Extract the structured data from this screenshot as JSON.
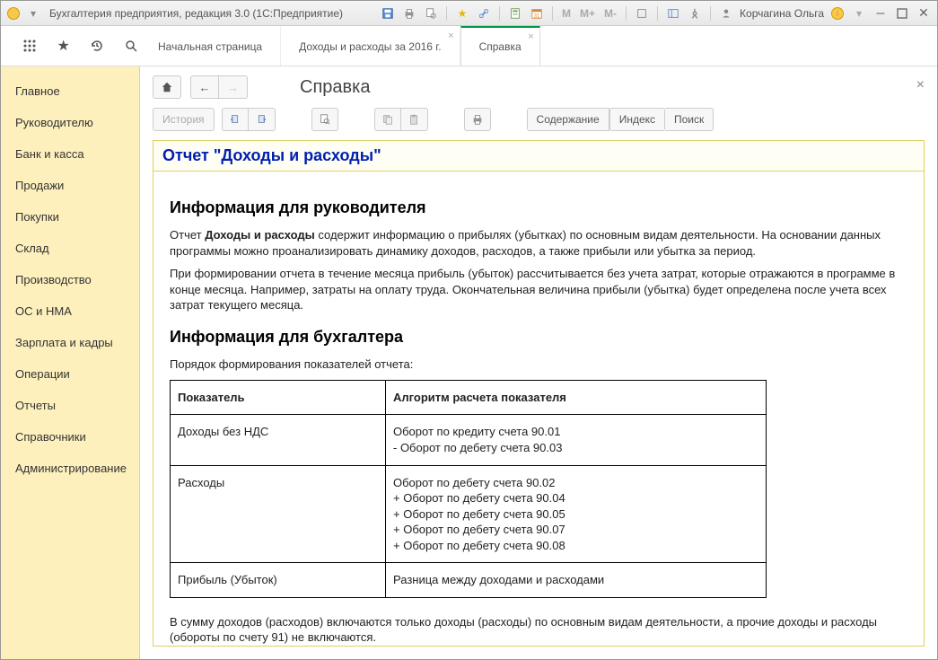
{
  "titlebar": {
    "app_title": "Бухгалтерия предприятия, редакция 3.0  (1С:Предприятие)",
    "user_name": "Корчагина Ольга",
    "labels": {
      "m": "M",
      "mplus": "M+",
      "mminus": "M-"
    }
  },
  "topnav": {
    "tabs": [
      {
        "label": "Начальная страница",
        "active": false,
        "closable": false
      },
      {
        "label": "Доходы и расходы за 2016 г.",
        "active": false,
        "closable": true
      },
      {
        "label": "Справка",
        "active": true,
        "closable": true
      }
    ]
  },
  "sidebar": {
    "items": [
      "Главное",
      "Руководителю",
      "Банк и касса",
      "Продажи",
      "Покупки",
      "Склад",
      "Производство",
      "ОС и НМА",
      "Зарплата и кадры",
      "Операции",
      "Отчеты",
      "Справочники",
      "Администрирование"
    ]
  },
  "main": {
    "page_title": "Справка",
    "toolbar": {
      "history_label": "История",
      "contents_label": "Содержание",
      "index_label": "Индекс",
      "search_label": "Поиск"
    },
    "help": {
      "title": "Отчет \"Доходы и расходы\"",
      "h_manager": "Информация для руководителя",
      "p1a": "Отчет ",
      "p1b": "Доходы и расходы",
      "p1c": " содержит информацию о прибылях (убытках) по основным видам деятельности. На основании данных программы можно проанализировать динамику доходов, расходов, а также прибыли или убытка за период.",
      "p2": "При формировании отчета в течение месяца прибыль (убыток) рассчитывается без учета затрат, которые отражаются в программе в конце месяца. Например, затраты на оплату труда. Окончательная величина прибыли (убытка) будет определена после учета всех затрат текущего месяца.",
      "h_acc": "Информация для бухгалтера",
      "p3": "Порядок формирования показателей отчета:",
      "table": {
        "headers": [
          "Показатель",
          "Алгоритм расчета показателя"
        ],
        "rows": [
          {
            "c1": "Доходы без НДС",
            "c2": "Оборот по кредиту счета 90.01\n- Оборот по дебету счета 90.03"
          },
          {
            "c1": "Расходы",
            "c2": "Оборот по дебету счета 90.02\n+ Оборот по дебету счета 90.04\n+ Оборот по дебету счета 90.05\n+ Оборот по дебету счета 90.07\n+ Оборот по дебету счета 90.08"
          },
          {
            "c1": "Прибыль (Убыток)",
            "c2": "Разница между доходами и расходами"
          }
        ]
      },
      "p4": "В сумму доходов (расходов) включаются только доходы (расходы) по основным видам деятельности, а прочие доходы и расходы (обороты по счету 91) не включаются."
    }
  }
}
